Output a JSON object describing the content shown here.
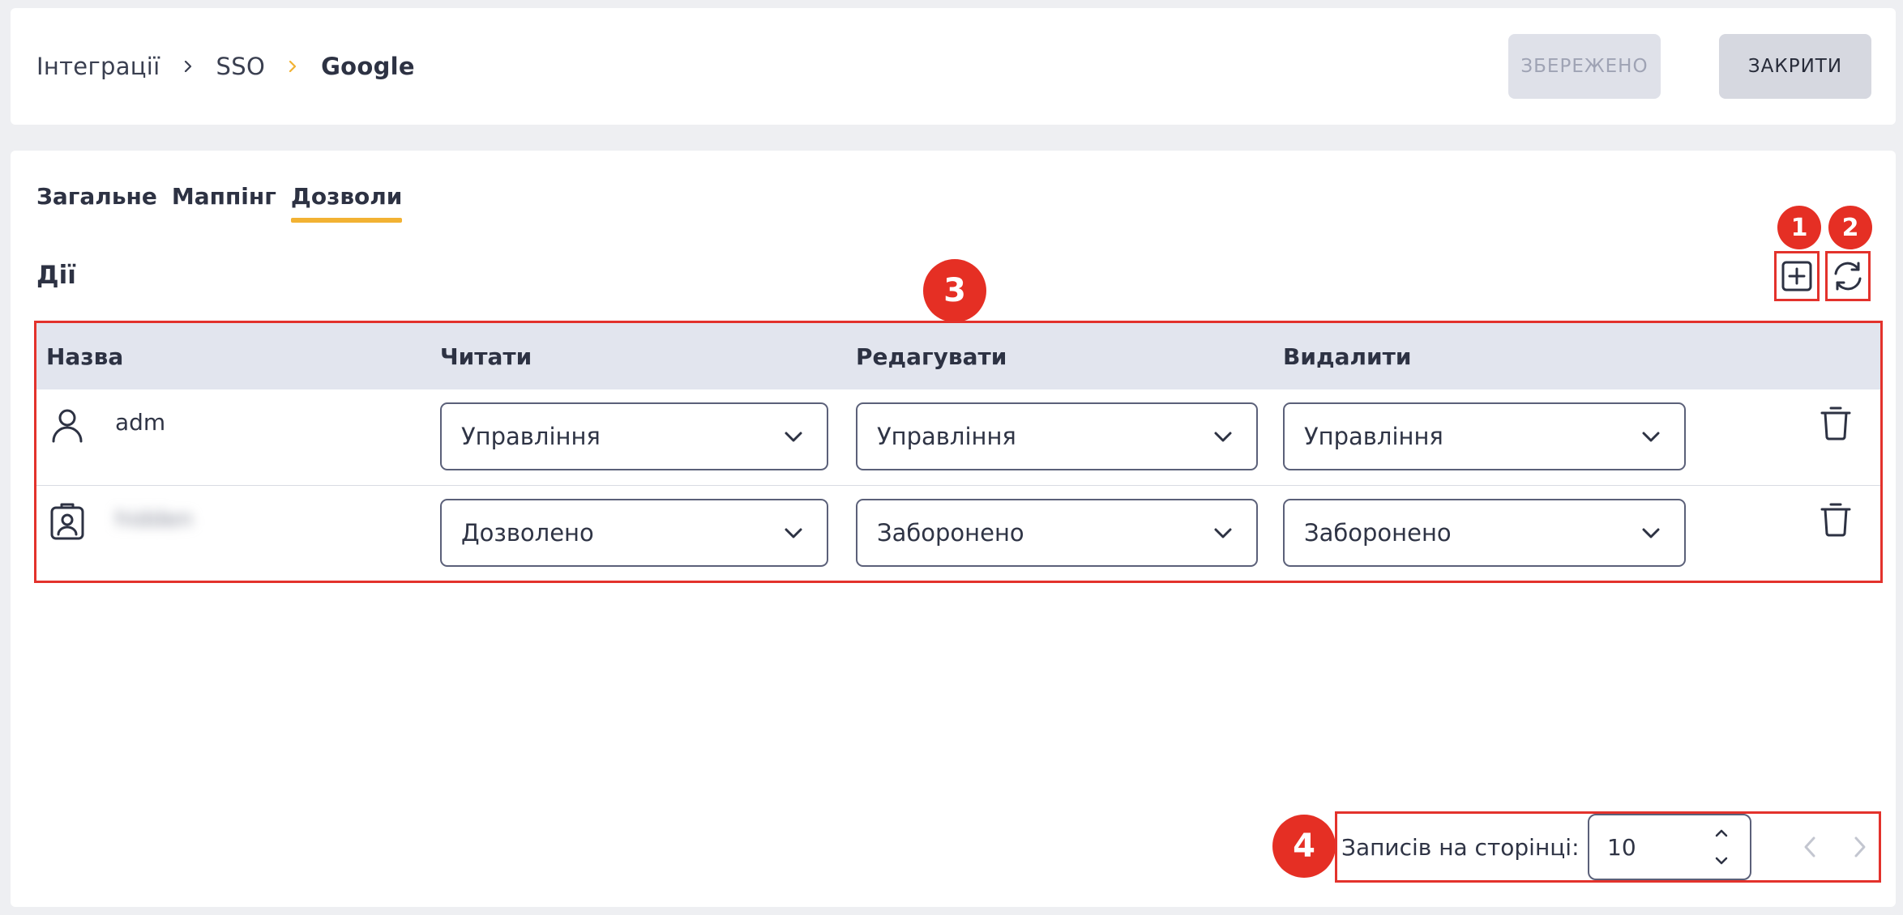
{
  "breadcrumb": {
    "items": [
      "Інтеграції",
      "SSO",
      "Google"
    ]
  },
  "header": {
    "saved_label": "ЗБЕРЕЖЕНО",
    "close_label": "ЗАКРИТИ"
  },
  "tabs": [
    {
      "label": "Загальне",
      "active": false
    },
    {
      "label": "Маппінг",
      "active": false
    },
    {
      "label": "Дозволи",
      "active": true
    }
  ],
  "section": {
    "title": "Дії"
  },
  "table": {
    "columns": [
      "Назва",
      "Читати",
      "Редагувати",
      "Видалити"
    ],
    "rows": [
      {
        "icon": "user-icon",
        "name": "adm",
        "read": "Управління",
        "edit": "Управління",
        "delete": "Управління"
      },
      {
        "icon": "group-badge-icon",
        "name": "hidden",
        "read": "Дозволено",
        "edit": "Заборонено",
        "delete": "Заборонено"
      }
    ]
  },
  "pagination": {
    "label": "Записів на сторінці:",
    "per_page": "10"
  },
  "annotations": {
    "badges": [
      "1",
      "2",
      "3",
      "4"
    ]
  },
  "colors": {
    "accent": "#f2b233",
    "annotation": "#e3322c",
    "text": "#2d3243"
  }
}
